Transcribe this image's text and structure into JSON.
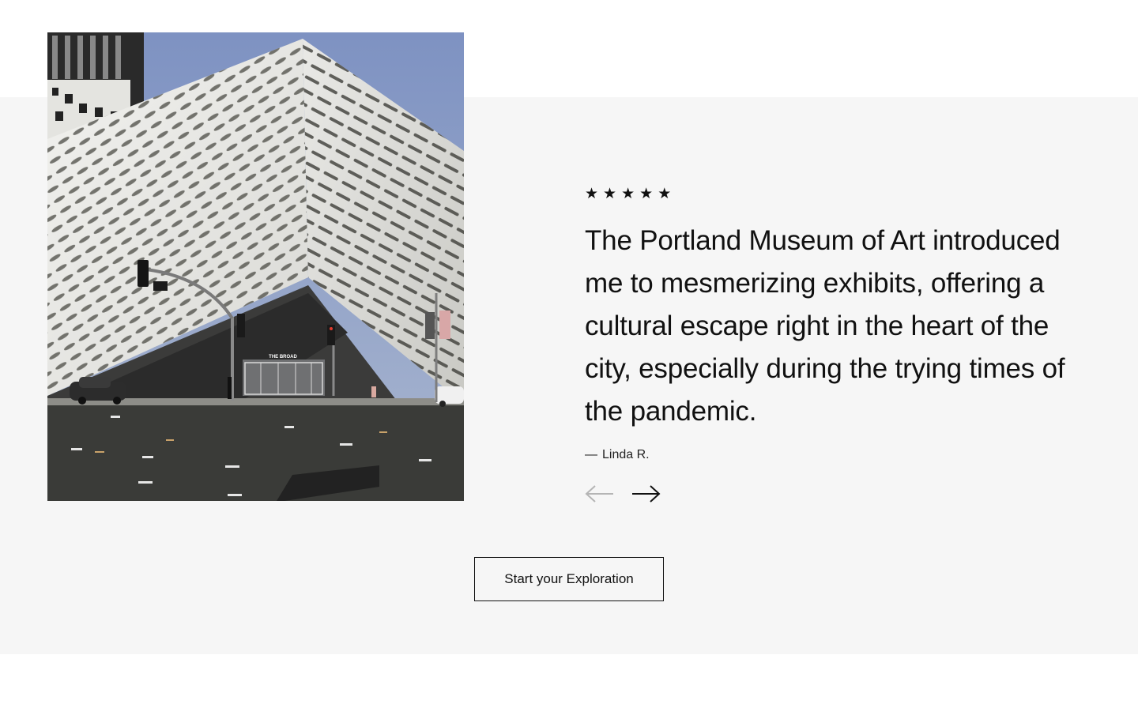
{
  "rating": {
    "stars": [
      "★",
      "★",
      "★",
      "★",
      "★"
    ]
  },
  "testimonial": {
    "quote": "The Portland Museum of Art introduced me to mesmerizing exhibits, offering a cultural escape right in the heart of the city, especially during the trying times of the pandemic.",
    "author_dash": "—",
    "author": "Linda R."
  },
  "carousel": {
    "prev_icon": "arrow-left-icon",
    "next_icon": "arrow-right-icon"
  },
  "cta": {
    "label": "Start your Exploration"
  },
  "image": {
    "sign_text": "THE BROAD"
  },
  "colors": {
    "band_background": "#f6f6f6",
    "text": "#111111",
    "arrow_disabled": "#b5b5b5"
  }
}
